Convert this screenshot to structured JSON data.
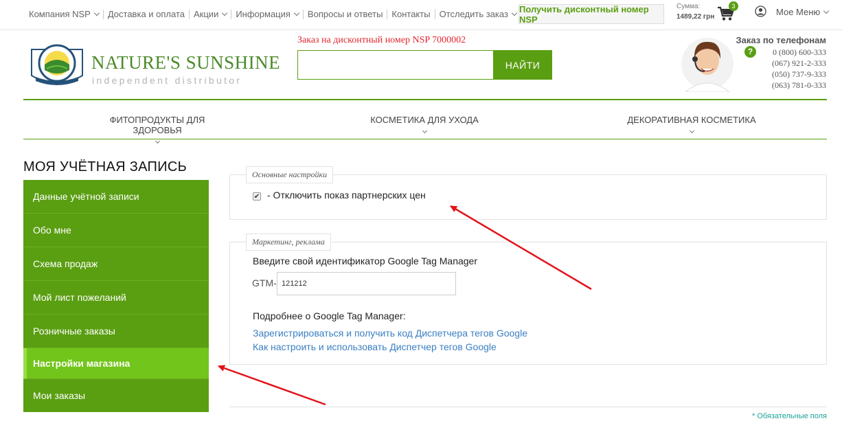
{
  "topbar": {
    "nav": [
      {
        "label": "Компания NSP",
        "dropdown": true
      },
      {
        "label": "Доставка и оплата",
        "dropdown": false
      },
      {
        "label": "Акции",
        "dropdown": true
      },
      {
        "label": "Информация",
        "dropdown": true
      },
      {
        "label": "Вопросы и ответы",
        "dropdown": false
      },
      {
        "label": "Контакты",
        "dropdown": false
      },
      {
        "label": "Отследить заказ",
        "dropdown": true
      }
    ],
    "discount_button": "Получить дисконтный номер NSP",
    "sum_label": "Сумма:",
    "sum_value": "1489,22 грн",
    "cart_count": "3",
    "menu_label": "Мое Меню"
  },
  "header": {
    "logo_title": "NATURE'S SUNSHINE",
    "logo_subtitle": "independent distributor",
    "logo_badge_text": "NATURE'S SUNSHINE · QUALITY, SERVICE, INTEGRITY",
    "order_note": "Заказ на дисконтный номер NSP 7000002",
    "search_value": "",
    "search_button": "НАЙТИ",
    "phone_title": "Заказ по телефонам",
    "help_icon": "?",
    "phones": [
      "0 (800) 600-333",
      "(067) 921-2-333",
      "(050) 737-9-333",
      "(063) 781-0-333"
    ]
  },
  "categories": [
    "ФИТОПРОДУКТЫ ДЛЯ ЗДОРОВЬЯ",
    "КОСМЕТИКА ДЛЯ УХОДА",
    "ДЕКОРАТИВНАЯ КОСМЕТИКА"
  ],
  "account": {
    "title": "МОЯ УЧЁТНАЯ ЗАПИСЬ",
    "menu": [
      {
        "label": "Данные учётной записи",
        "active": false
      },
      {
        "label": "Обо мне",
        "active": false
      },
      {
        "label": "Схема продаж",
        "active": false
      },
      {
        "label": "Мой лист пожеланий",
        "active": false
      },
      {
        "label": "Розничные заказы",
        "active": false
      },
      {
        "label": "Настройки магазина",
        "active": true
      },
      {
        "label": "Мои заказы",
        "active": false
      }
    ]
  },
  "settings": {
    "basic_legend": "Основные настройки",
    "hide_partner_prices_checked": true,
    "hide_partner_prices_label": "- Отключить показ партнерских цен",
    "marketing_legend": "Маркетинг, реклама",
    "gtm_label": "Введите свой идентификатор Google Tag Manager",
    "gtm_prefix": "GTM-",
    "gtm_value": "121212",
    "more_label": "Подробнее о Google Tag Manager:",
    "link_register": "Зарегистрироваться и получить код Диспетчера тегов Google",
    "link_howto": "Как настроить и использовать Диспетчер тегов Google",
    "required_note": "* Обязательные поля"
  },
  "colors": {
    "brand_green": "#5a9e12",
    "active_green": "#72c51a",
    "accent_red": "#e2272e",
    "link_blue": "#3a7fc2"
  }
}
